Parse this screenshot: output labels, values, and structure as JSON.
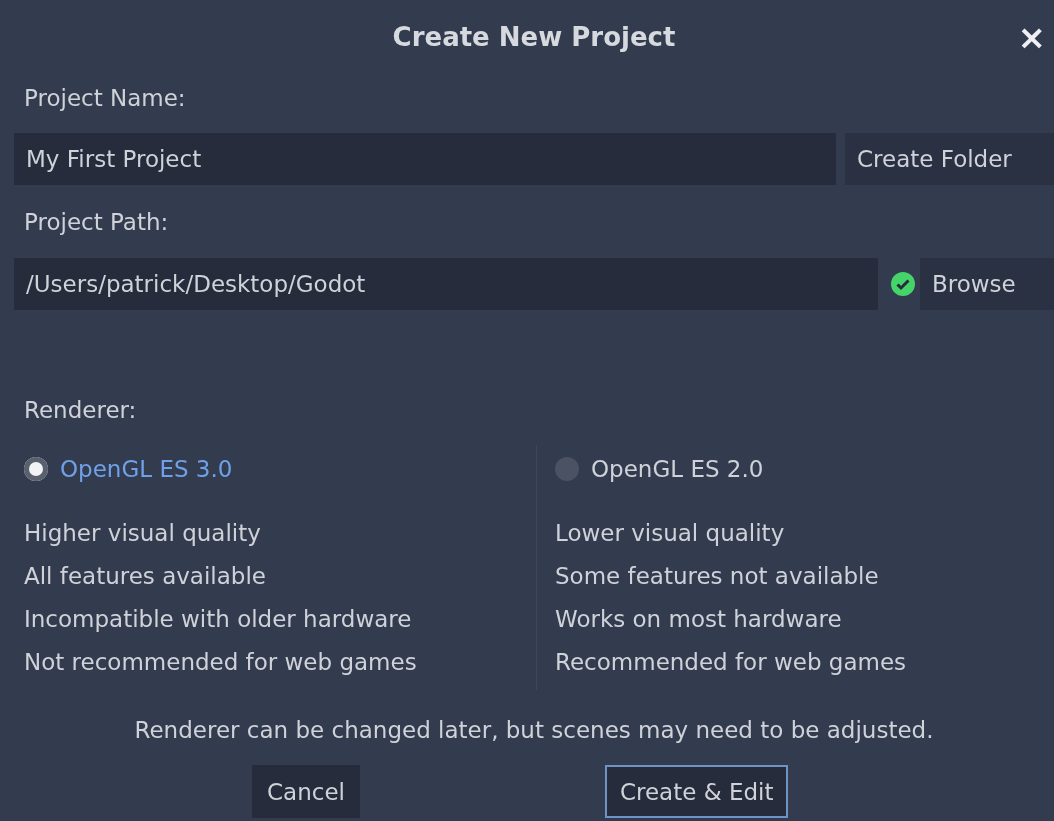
{
  "dialog": {
    "title": "Create New Project",
    "close": "×"
  },
  "project_name": {
    "label": "Project Name:",
    "value": "My First Project",
    "button": "Create Folder"
  },
  "project_path": {
    "label": "Project Path:",
    "value": "/Users/patrick/Desktop/Godot",
    "valid": true,
    "button": "Browse"
  },
  "renderer": {
    "label": "Renderer:",
    "options": [
      {
        "label": "OpenGL ES 3.0",
        "selected": true,
        "features": [
          "Higher visual quality",
          "All features available",
          "Incompatible with older hardware",
          "Not recommended for web games"
        ]
      },
      {
        "label": "OpenGL ES 2.0",
        "selected": false,
        "features": [
          "Lower visual quality",
          "Some features not available",
          "Works on most hardware",
          "Recommended for web games"
        ]
      }
    ],
    "note": "Renderer can be changed later, but scenes may need to be adjusted."
  },
  "buttons": [
    {
      "label": "Cancel",
      "focused": false
    },
    {
      "label": "Create & Edit",
      "focused": true
    }
  ]
}
